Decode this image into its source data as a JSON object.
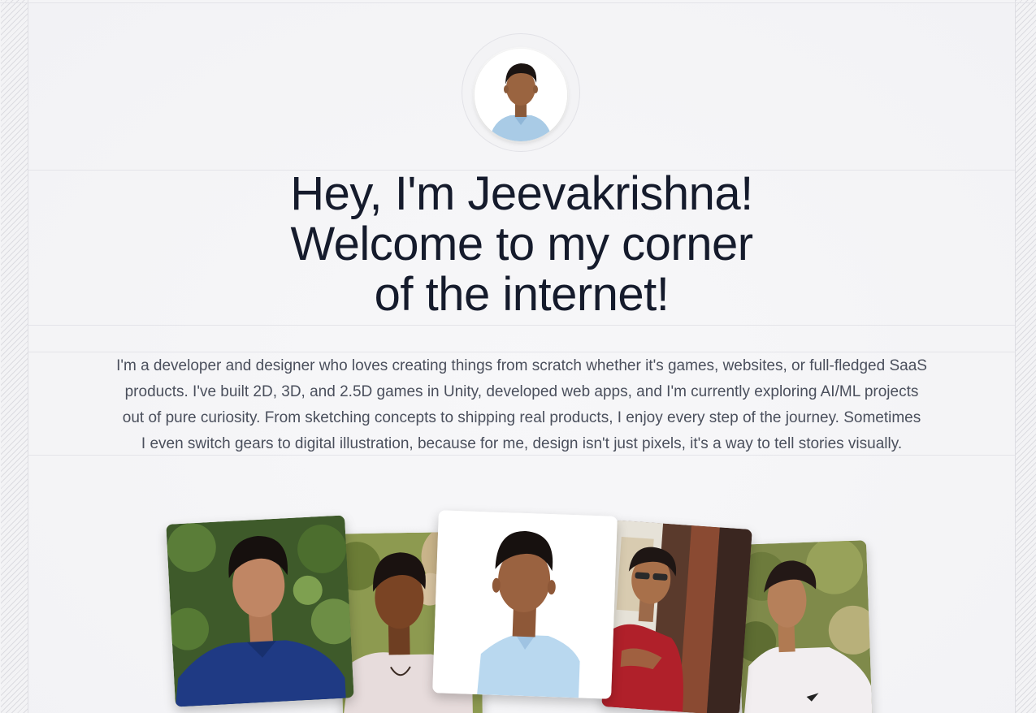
{
  "hero": {
    "line1": "Hey, I'm Jeevakrishna!",
    "line2": "Welcome to my corner",
    "line3": "of the internet!"
  },
  "bio": {
    "line1": "I'm a developer and designer who loves creating things from scratch whether it's games, websites, or full-fledged SaaS",
    "line2": "products. I've built 2D, 3D, and 2.5D games in Unity, developed web apps, and I'm currently exploring AI/ML projects",
    "line3": "out of pure curiosity. From sketching concepts to shipping real products, I enjoy every step of the journey. Sometimes",
    "line4": "I even switch gears to digital illustration, because for me, design isn't just pixels, it's a way to tell stories visually."
  },
  "colors": {
    "background": "#f4f4f6",
    "heading": "#151b2c",
    "body_text": "#4a4f5c",
    "divider": "#e4e4e9"
  },
  "icons": [
    "profile-avatar",
    "photo-garden-blue-shirt",
    "photo-flowers-white-tee",
    "photo-studio-light-blue-shirt",
    "photo-sunglasses-red-shirt",
    "photo-profile-white-tee"
  ]
}
